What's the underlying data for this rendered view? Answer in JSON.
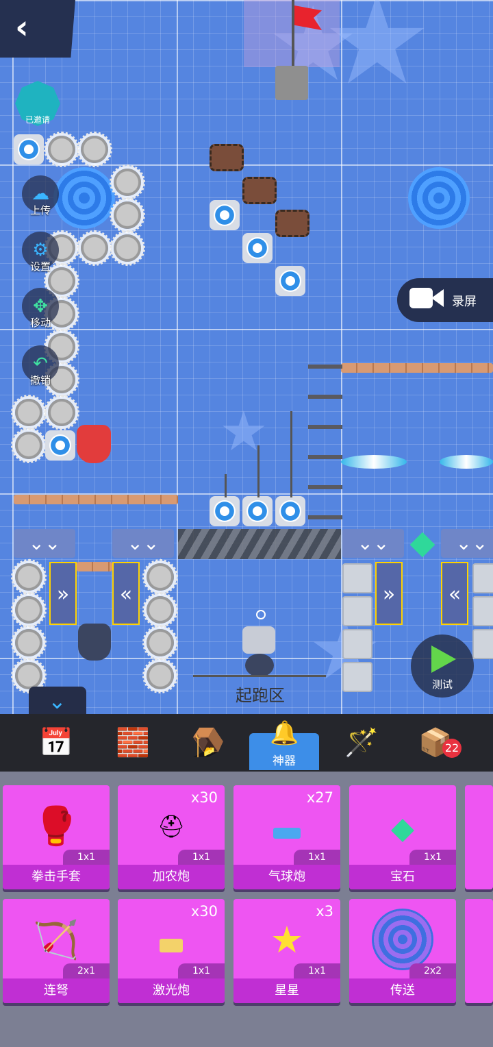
{
  "nav": {
    "back_icon": "back-arrow-icon"
  },
  "status": {
    "invited_label": "已邀请"
  },
  "side_buttons": [
    {
      "label": "上传",
      "icon": "cloud-upload-icon"
    },
    {
      "label": "设置",
      "icon": "gear-icon"
    },
    {
      "label": "移动",
      "icon": "move-arrows-icon"
    },
    {
      "label": "撤销",
      "icon": "undo-icon"
    }
  ],
  "record": {
    "label": "录屏",
    "icon": "video-camera-icon"
  },
  "test": {
    "label": "测试",
    "icon": "play-icon"
  },
  "zone": {
    "start_label": "起跑区"
  },
  "toolbar": {
    "active_label": "神器",
    "box_badge": "22",
    "collapse_icon": "chevron-down-icon",
    "tools": [
      "calendar-star-icon",
      "eraser-block-icon",
      "trap-jaw-icon",
      "artifact-icon",
      "magic-wand-icon",
      "box-icon"
    ]
  },
  "items": [
    {
      "name": "拳击手套",
      "count": "",
      "size": "1x1",
      "icon": "boxing-glove-icon"
    },
    {
      "name": "加农炮",
      "count": "x30",
      "size": "1x1",
      "icon": "cannon-icon"
    },
    {
      "name": "气球炮",
      "count": "x27",
      "size": "1x1",
      "icon": "balloon-cannon-icon"
    },
    {
      "name": "宝石",
      "count": "",
      "size": "1x1",
      "icon": "gem-icon"
    },
    {
      "name": "连弩",
      "count": "",
      "size": "2x1",
      "icon": "crossbow-icon"
    },
    {
      "name": "激光炮",
      "count": "x30",
      "size": "1x1",
      "icon": "laser-cannon-icon"
    },
    {
      "name": "星星",
      "count": "x3",
      "size": "1x1",
      "icon": "star-icon"
    },
    {
      "name": "传送",
      "count": "",
      "size": "2x2",
      "icon": "teleport-icon"
    }
  ]
}
